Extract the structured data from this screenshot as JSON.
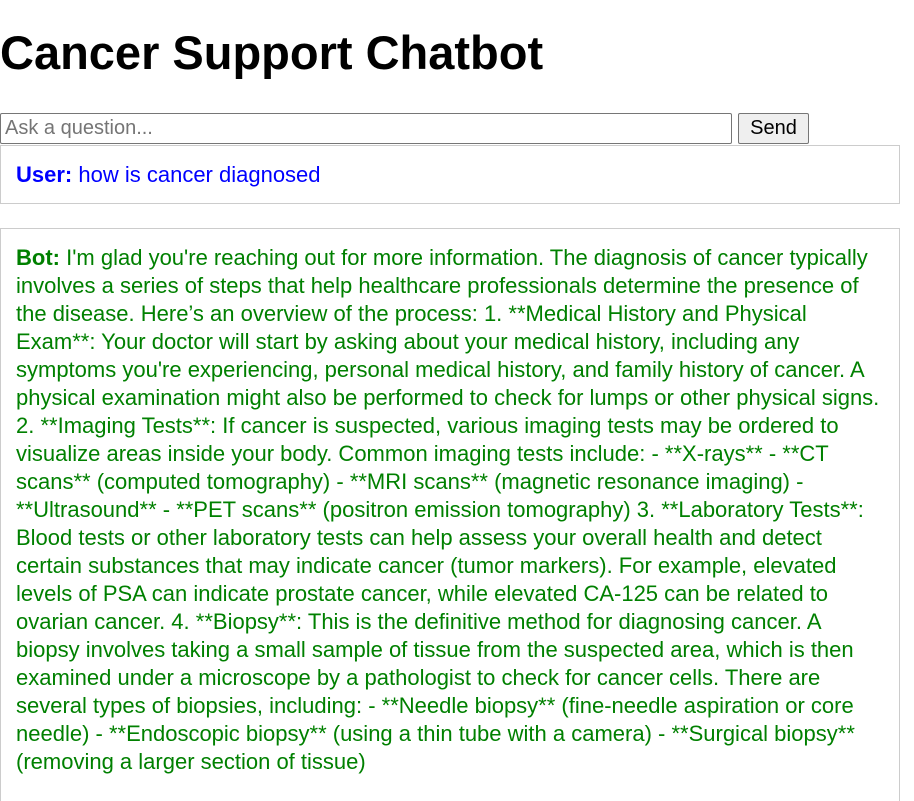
{
  "page": {
    "title": "Cancer Support Chatbot"
  },
  "composer": {
    "placeholder": "Ask a question...",
    "send_label": "Send"
  },
  "colors": {
    "user_text": "#0000ff",
    "bot_text": "#008000"
  },
  "conversation": {
    "user": {
      "speaker": "User:",
      "text": "how is cancer diagnosed"
    },
    "bot": {
      "speaker": "Bot:",
      "text": "I'm glad you're reaching out for more information. The diagnosis of cancer typically involves a series of steps that help healthcare professionals determine the presence of the disease. Here’s an overview of the process: 1. **Medical History and Physical Exam**: Your doctor will start by asking about your medical history, including any symptoms you're experiencing, personal medical history, and family history of cancer. A physical examination might also be performed to check for lumps or other physical signs. 2. **Imaging Tests**: If cancer is suspected, various imaging tests may be ordered to visualize areas inside your body. Common imaging tests include: - **X-rays** - **CT scans** (computed tomography) - **MRI scans** (magnetic resonance imaging) - **Ultrasound** - **PET scans** (positron emission tomography) 3. **Laboratory Tests**: Blood tests or other laboratory tests can help assess your overall health and detect certain substances that may indicate cancer (tumor markers). For example, elevated levels of PSA can indicate prostate cancer, while elevated CA-125 can be related to ovarian cancer. 4. **Biopsy**: This is the definitive method for diagnosing cancer. A biopsy involves taking a small sample of tissue from the suspected area, which is then examined under a microscope by a pathologist to check for cancer cells. There are several types of biopsies, including: - **Needle biopsy** (fine-needle aspiration or core needle) - **Endoscopic biopsy** (using a thin tube with a camera) - **Surgical biopsy** (removing a larger section of tissue)"
    }
  }
}
